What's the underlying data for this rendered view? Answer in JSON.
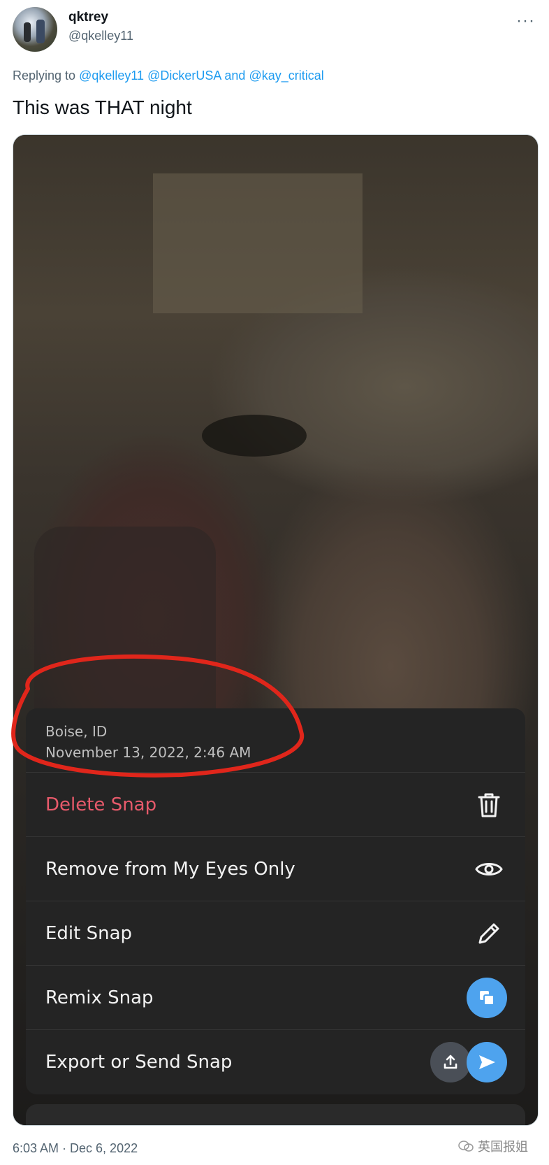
{
  "tweet": {
    "display_name": "qktrey",
    "handle": "@qkelley11",
    "more_label": "···",
    "replying_prefix": "Replying to",
    "mentions": [
      "@qkelley11",
      "@DickerUSA",
      "and",
      "@kay_critical"
    ],
    "text": "This was THAT night",
    "timestamp": "6:03 AM · Dec 6, 2022"
  },
  "snap_menu": {
    "location": "Boise, ID",
    "datetime": "November 13, 2022, 2:46 AM",
    "items": [
      {
        "label": "Delete Snap",
        "icon": "trash-icon",
        "color": "#e85a6b"
      },
      {
        "label": "Remove from My Eyes Only",
        "icon": "eye-icon"
      },
      {
        "label": "Edit Snap",
        "icon": "pencil-icon"
      },
      {
        "label": "Remix Snap",
        "icon": "remix-icon"
      },
      {
        "label": "Export or Send Snap",
        "icon": "share-icon"
      }
    ]
  },
  "watermark": "英国报姐",
  "colors": {
    "link": "#1d9bf0",
    "annotation_red": "#e0261b",
    "snap_blue": "#4ea3ee",
    "menu_bg": "#242424"
  }
}
